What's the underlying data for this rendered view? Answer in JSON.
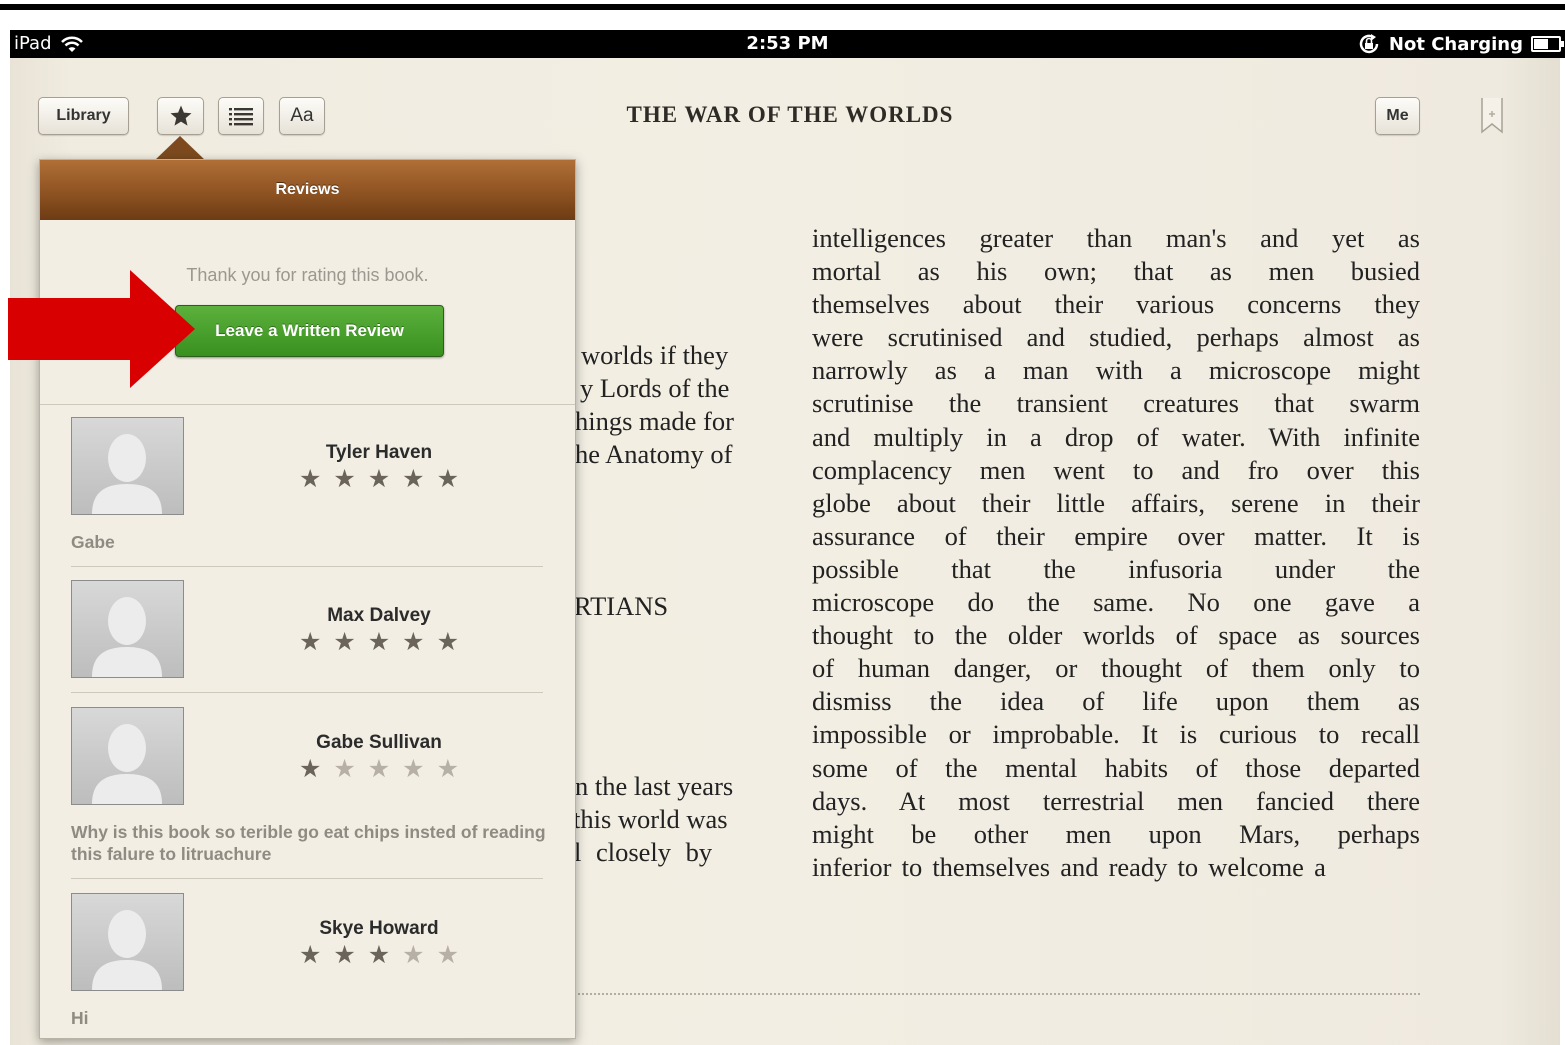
{
  "status_bar": {
    "device": "iPad",
    "time": "2:53 PM",
    "battery_status": "Not Charging",
    "icons": [
      "wifi-icon",
      "rotation-lock-icon",
      "battery-icon"
    ]
  },
  "toolbar": {
    "library_label": "Library",
    "font_button_label": "Aa",
    "me_label": "Me",
    "book_title": "THE WAR OF THE WORLDS",
    "icons": [
      "star-icon",
      "list-icon",
      "bookmark-icon"
    ]
  },
  "reviews_popover": {
    "title": "Reviews",
    "thank_you": "Thank you for rating this book.",
    "write_review_label": "Leave a Written Review",
    "reviews": [
      {
        "name": "Tyler Haven",
        "rating": 5,
        "text": "Gabe"
      },
      {
        "name": "Max Dalvey",
        "rating": 5,
        "text": ""
      },
      {
        "name": "Gabe Sullivan",
        "rating": 1,
        "text": "Why is this book so terible go eat chips insted of reading this falure to litruachure"
      },
      {
        "name": "Skye Howard",
        "rating": 3,
        "text": "Hi"
      }
    ]
  },
  "annotation": {
    "arrow_color": "#d80000",
    "points_to": "Leave a Written Review"
  },
  "left_page_fragments": [
    "worlds if they",
    "y Lords of the",
    "hings made for",
    "he Anatomy of",
    "RTIANS",
    "n the last years",
    "this world was",
    "l closely by"
  ],
  "right_page_lines": [
    "intelligences greater than man's and yet as",
    "mortal as his own; that as men busied",
    "themselves about their various concerns they",
    "were scrutinised and studied, perhaps almost as",
    "narrowly as a man with a microscope might",
    "scrutinise the transient creatures that swarm",
    "and multiply in a drop of water. With infinite",
    "complacency men went to and fro over this",
    "globe about their little affairs, serene in their",
    "assurance of their empire over matter. It is",
    "possible that the infusoria under the",
    "microscope do the same. No one gave a",
    "thought to the older worlds of space as sources",
    "of human danger, or thought of them only to",
    "dismiss the idea of life upon them as",
    "impossible or improbable. It is curious to recall",
    "some of the mental habits of those departed",
    "days. At most terrestrial men fancied there",
    "might be other men upon Mars, perhaps",
    "inferior to themselves and ready to welcome a"
  ],
  "colors": {
    "wood_header": "#8e5322",
    "green_button": "#39901f",
    "page_background": "#f2eee3"
  }
}
